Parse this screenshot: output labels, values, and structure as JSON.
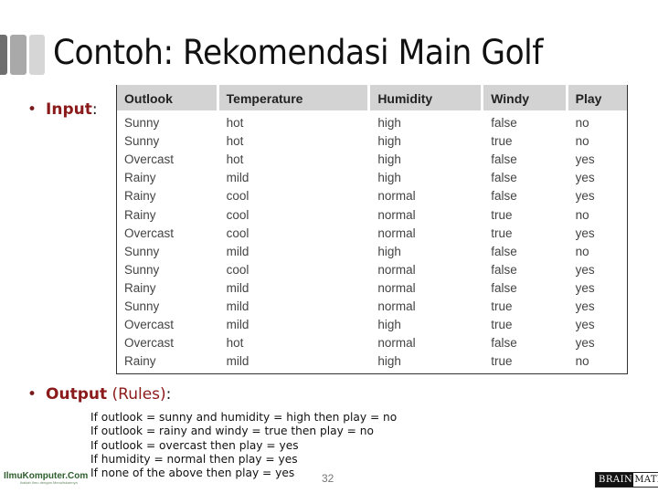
{
  "slide": {
    "title": "Contoh: Rekomendasi Main Golf",
    "page_number": "32"
  },
  "input_bullet": {
    "label": "Input",
    "suffix": ":"
  },
  "output_bullet": {
    "label": "Output",
    "paren": "(Rules)",
    "suffix": ":"
  },
  "table": {
    "headers": [
      "Outlook",
      "Temperature",
      "Humidity",
      "Windy",
      "Play"
    ],
    "rows": [
      [
        "Sunny",
        "hot",
        "high",
        "false",
        "no"
      ],
      [
        "Sunny",
        "hot",
        "high",
        "true",
        "no"
      ],
      [
        "Overcast",
        "hot",
        "high",
        "false",
        "yes"
      ],
      [
        "Rainy",
        "mild",
        "high",
        "false",
        "yes"
      ],
      [
        "Rainy",
        "cool",
        "normal",
        "false",
        "yes"
      ],
      [
        "Rainy",
        "cool",
        "normal",
        "true",
        "no"
      ],
      [
        "Overcast",
        "cool",
        "normal",
        "true",
        "yes"
      ],
      [
        "Sunny",
        "mild",
        "high",
        "false",
        "no"
      ],
      [
        "Sunny",
        "cool",
        "normal",
        "false",
        "yes"
      ],
      [
        "Rainy",
        "mild",
        "normal",
        "false",
        "yes"
      ],
      [
        "Sunny",
        "mild",
        "normal",
        "true",
        "yes"
      ],
      [
        "Overcast",
        "mild",
        "high",
        "true",
        "yes"
      ],
      [
        "Overcast",
        "hot",
        "normal",
        "false",
        "yes"
      ],
      [
        "Rainy",
        "mild",
        "high",
        "true",
        "no"
      ]
    ]
  },
  "rules": [
    "If outlook = sunny and humidity = high then play = no",
    "If outlook = rainy and windy = true then play = no",
    "If outlook = overcast then play = yes",
    "If humidity = normal then play = yes",
    "If none of the above then play = yes"
  ],
  "footer": {
    "left_logo": "IlmuKomputer.Com",
    "left_logo_tagline": "Ikatlah Ilmu dengan Menuliskannya",
    "right_logo_dark": "BRAIN",
    "right_logo_light": "MATICS"
  },
  "colors": {
    "accent_red": "#8b1a1a",
    "table_header_bg": "#d3d3d3"
  }
}
